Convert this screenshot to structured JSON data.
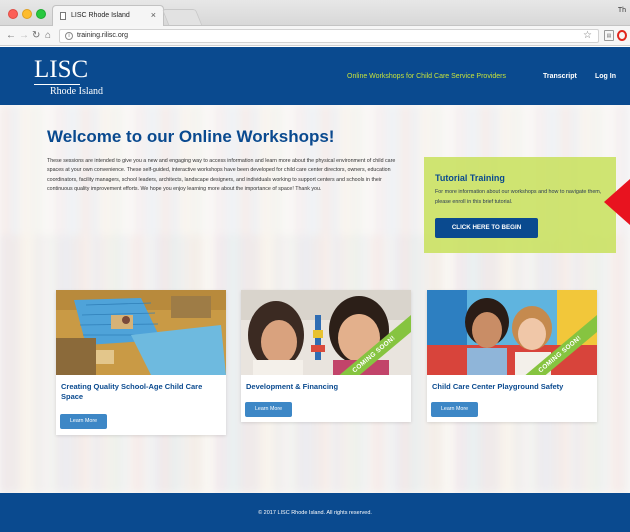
{
  "browser": {
    "tab_title": "LISC Rhode Island",
    "tab_close": "×",
    "profile_label": "Th",
    "url": "training.rilisc.org"
  },
  "header": {
    "logo_main": "LISC",
    "logo_sub": "Rhode Island",
    "nav": {
      "workshops": "Online Workshops for Child Care Service Providers",
      "transcript": "Transcript",
      "login": "Log In"
    },
    "accent_color": "#c6e23a",
    "brand_color": "#0a4a8f"
  },
  "hero": {
    "title": "Welcome to our Online Workshops!",
    "intro": "These sessions are intended to give you a new and engaging way to access information and learn more about the physical environment of child care spaces at your own convenience. These self-guided, interactive workshops have been developed for child care center directors, owners, education coordinators, facility managers, school leaders, architects, landscape designers, and individuals working to support centers and schools in their continuous quality improvement efforts. We hope you enjoy learning more about the importance of space! Thank you.",
    "tutorial": {
      "title": "Tutorial Training",
      "text": "For more information about our workshops and how to navigate them, please enroll in this brief tutorial.",
      "button": "CLICK HERE TO BEGIN"
    }
  },
  "workshops": [
    {
      "title": "Creating Quality School-Age Child Care Space",
      "button": "Learn More",
      "ribbon": ""
    },
    {
      "title": "Development & Financing",
      "button": "Learn More",
      "ribbon": "COMING SOON!"
    },
    {
      "title": "Child Care Center Playground Safety",
      "button": "Learn More",
      "ribbon": "COMING SOON!"
    }
  ],
  "footer": {
    "text": "© 2017 LISC Rhode Island. All rights reserved."
  }
}
